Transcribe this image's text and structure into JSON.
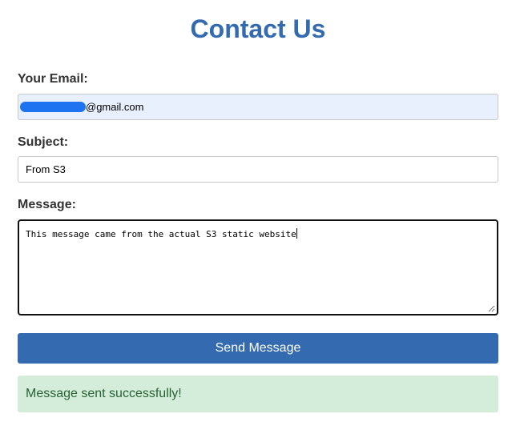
{
  "form": {
    "title": "Contact Us",
    "email": {
      "label": "Your Email:",
      "value_suffix": "@gmail.com"
    },
    "subject": {
      "label": "Subject:",
      "value": "From S3"
    },
    "message": {
      "label": "Message:",
      "value": "This message came from the actual S3 static website"
    },
    "send_label": "Send Message",
    "status_message": "Message sent successfully!"
  },
  "colors": {
    "title": "#336ab0",
    "button": "#336ab0",
    "success_bg": "#d4edda",
    "success_text": "#276233",
    "autofill_bg": "#e8f0fe"
  }
}
